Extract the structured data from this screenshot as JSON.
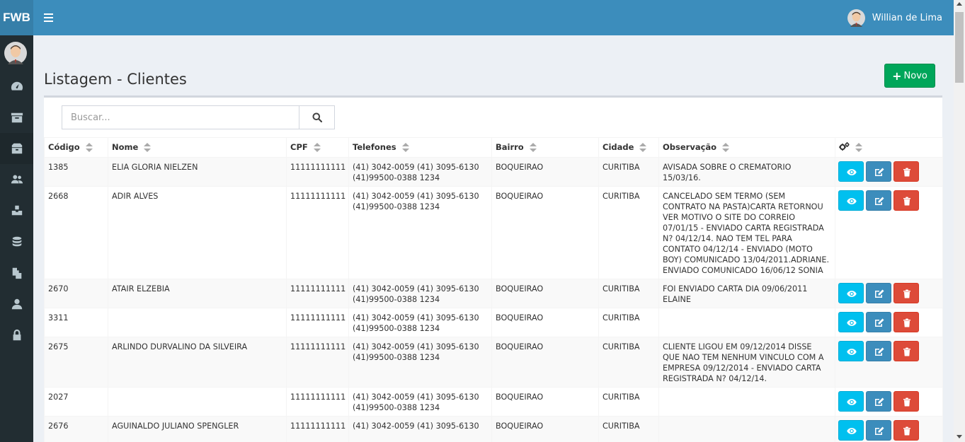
{
  "app": {
    "logo": "FWB",
    "user_name": "Willian de Lima"
  },
  "colors": {
    "header": "#3c8dbc",
    "sidebar": "#222d32",
    "success": "#00a65a",
    "info": "#00c0ef",
    "primary": "#3c8dbc",
    "danger": "#dd4b39"
  },
  "sidebar": {
    "items": [
      {
        "icon": "dashboard-icon"
      },
      {
        "icon": "archive-icon"
      },
      {
        "icon": "dropbox-icon",
        "active": true
      },
      {
        "icon": "users-icon"
      },
      {
        "icon": "cubes-icon"
      },
      {
        "icon": "database-icon"
      },
      {
        "icon": "files-icon"
      },
      {
        "icon": "user-icon"
      },
      {
        "icon": "lock-icon"
      }
    ]
  },
  "page": {
    "title": "Listagem - Clientes",
    "new_button": "Novo"
  },
  "search": {
    "placeholder": "Buscar..."
  },
  "table": {
    "columns": [
      "Código",
      "Nome",
      "CPF",
      "Telefones",
      "Bairro",
      "Cidade",
      "Observação"
    ],
    "settings_icon": "gears-icon",
    "rows": [
      {
        "codigo": "1385",
        "nome": "ELIA GLORIA NIELZEN",
        "cpf": "11111111111",
        "telefones": "(41) 3042-0059 (41) 3095-6130 (41)99500-0388 1234",
        "bairro": "BOQUEIRAO",
        "cidade": "CURITIBA",
        "obs": "AVISADA SOBRE O CREMATORIO 15/03/16."
      },
      {
        "codigo": "2668",
        "nome": "ADIR ALVES",
        "cpf": "11111111111",
        "telefones": "(41) 3042-0059 (41) 3095-6130 (41)99500-0388 1234",
        "bairro": "BOQUEIRAO",
        "cidade": "CURITIBA",
        "obs": "CANCELADO SEM TERMO (SEM CONTRATO NA PASTA)CARTA RETORNOU VER MOTIVO O SITE DO CORREIO 07/01/15 - ENVIADO CARTA REGISTRADA N? 04/12/14. NAO TEM TEL PARA CONTATO 04/12/14 - ENVIADO (MOTO BOY) COMUNICADO 13/04/2011.ADRIANE. ENVIADO COMUNICADO 16/06/12 SONIA"
      },
      {
        "codigo": "2670",
        "nome": "ATAIR ELZEBIA",
        "cpf": "11111111111",
        "telefones": "(41) 3042-0059 (41) 3095-6130 (41)99500-0388 1234",
        "bairro": "BOQUEIRAO",
        "cidade": "CURITIBA",
        "obs": "FOI ENVIADO CARTA DIA 09/06/2011 ELAINE"
      },
      {
        "codigo": "3311",
        "nome": "",
        "cpf": "11111111111",
        "telefones": "(41) 3042-0059 (41) 3095-6130 (41)99500-0388 1234",
        "bairro": "BOQUEIRAO",
        "cidade": "CURITIBA",
        "obs": ""
      },
      {
        "codigo": "2675",
        "nome": "ARLINDO DURVALINO DA SILVEIRA",
        "cpf": "11111111111",
        "telefones": "(41) 3042-0059 (41) 3095-6130 (41)99500-0388 1234",
        "bairro": "BOQUEIRAO",
        "cidade": "CURITIBA",
        "obs": "CLIENTE LIGOU EM 09/12/2014 DISSE QUE NAO TEM NENHUM VINCULO COM A EMPRESA 09/12/2014 - ENVIADO CARTA REGISTRADA N? 04/12/14."
      },
      {
        "codigo": "2027",
        "nome": "",
        "cpf": "11111111111",
        "telefones": "(41) 3042-0059 (41) 3095-6130 (41)99500-0388 1234",
        "bairro": "BOQUEIRAO",
        "cidade": "CURITIBA",
        "obs": ""
      },
      {
        "codigo": "2676",
        "nome": "AGUINALDO JULIANO SPENGLER",
        "cpf": "11111111111",
        "telefones": "(41) 3042-0059 (41) 3095-6130",
        "bairro": "BOQUEIRAO",
        "cidade": "CURITIBA",
        "obs": ""
      }
    ]
  }
}
